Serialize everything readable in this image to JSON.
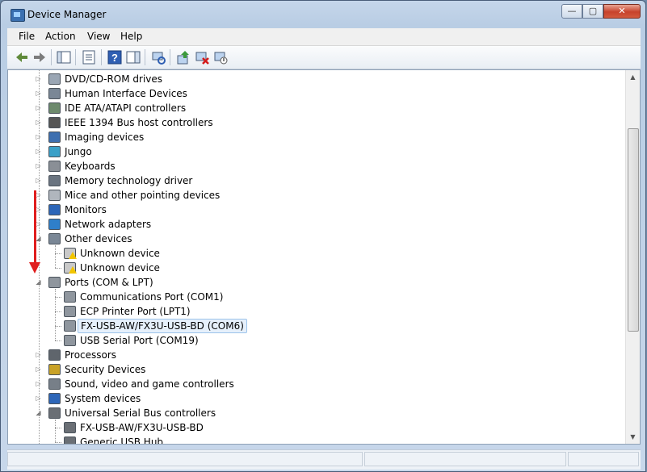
{
  "window": {
    "title": "Device Manager",
    "buttons": {
      "minimize": "—",
      "maximize": "▢",
      "close": "✕"
    }
  },
  "menu": [
    "File",
    "Action",
    "View",
    "Help"
  ],
  "toolbar": {
    "buttons": [
      "back-icon",
      "forward-icon",
      "console-tree-icon",
      "properties-icon",
      "help-icon",
      "action-pane-icon",
      "scan-hardware-icon",
      "update-driver-icon",
      "uninstall-icon",
      "disable-icon"
    ]
  },
  "tree": [
    {
      "label": "DVD/CD-ROM drives",
      "level": 1,
      "expander": "collapsed",
      "icon": "dvd-drive-icon"
    },
    {
      "label": "Human Interface Devices",
      "level": 1,
      "expander": "collapsed",
      "icon": "hid-icon"
    },
    {
      "label": "IDE ATA/ATAPI controllers",
      "level": 1,
      "expander": "collapsed",
      "icon": "ide-controller-icon"
    },
    {
      "label": "IEEE 1394 Bus host controllers",
      "level": 1,
      "expander": "collapsed",
      "icon": "ieee1394-icon"
    },
    {
      "label": "Imaging devices",
      "level": 1,
      "expander": "collapsed",
      "icon": "camera-icon"
    },
    {
      "label": "Jungo",
      "level": 1,
      "expander": "collapsed",
      "icon": "jungo-icon"
    },
    {
      "label": "Keyboards",
      "level": 1,
      "expander": "collapsed",
      "icon": "keyboard-icon"
    },
    {
      "label": "Memory technology driver",
      "level": 1,
      "expander": "collapsed",
      "icon": "memory-icon"
    },
    {
      "label": "Mice and other pointing devices",
      "level": 1,
      "expander": "collapsed",
      "icon": "mouse-icon"
    },
    {
      "label": "Monitors",
      "level": 1,
      "expander": "collapsed",
      "icon": "monitor-icon"
    },
    {
      "label": "Network adapters",
      "level": 1,
      "expander": "collapsed",
      "icon": "network-adapter-icon"
    },
    {
      "label": "Other devices",
      "level": 1,
      "expander": "expanded",
      "icon": "other-devices-icon"
    },
    {
      "label": "Unknown device",
      "level": 2,
      "expander": "",
      "icon": "unknown-device-warning-icon"
    },
    {
      "label": "Unknown device",
      "level": 2,
      "expander": "",
      "icon": "unknown-device-warning-icon"
    },
    {
      "label": "Ports (COM & LPT)",
      "level": 1,
      "expander": "expanded",
      "icon": "port-icon"
    },
    {
      "label": "Communications Port (COM1)",
      "level": 2,
      "expander": "",
      "icon": "port-icon"
    },
    {
      "label": "ECP Printer Port (LPT1)",
      "level": 2,
      "expander": "",
      "icon": "port-icon"
    },
    {
      "label": "FX-USB-AW/FX3U-USB-BD (COM6)",
      "level": 2,
      "expander": "",
      "icon": "port-icon",
      "selected": true
    },
    {
      "label": "USB Serial Port (COM19)",
      "level": 2,
      "expander": "",
      "icon": "port-icon"
    },
    {
      "label": "Processors",
      "level": 1,
      "expander": "collapsed",
      "icon": "processor-icon"
    },
    {
      "label": "Security Devices",
      "level": 1,
      "expander": "collapsed",
      "icon": "security-key-icon"
    },
    {
      "label": "Sound, video and game controllers",
      "level": 1,
      "expander": "collapsed",
      "icon": "sound-icon"
    },
    {
      "label": "System devices",
      "level": 1,
      "expander": "collapsed",
      "icon": "system-devices-icon"
    },
    {
      "label": "Universal Serial Bus controllers",
      "level": 1,
      "expander": "expanded",
      "icon": "usb-icon"
    },
    {
      "label": "FX-USB-AW/FX3U-USB-BD",
      "level": 2,
      "expander": "",
      "icon": "usb-icon"
    },
    {
      "label": "Generic USB Hub",
      "level": 2,
      "expander": "",
      "icon": "usb-icon"
    }
  ],
  "colors": {
    "annotation_arrow": "#e01e1e",
    "selection": "#e6f0fb"
  }
}
